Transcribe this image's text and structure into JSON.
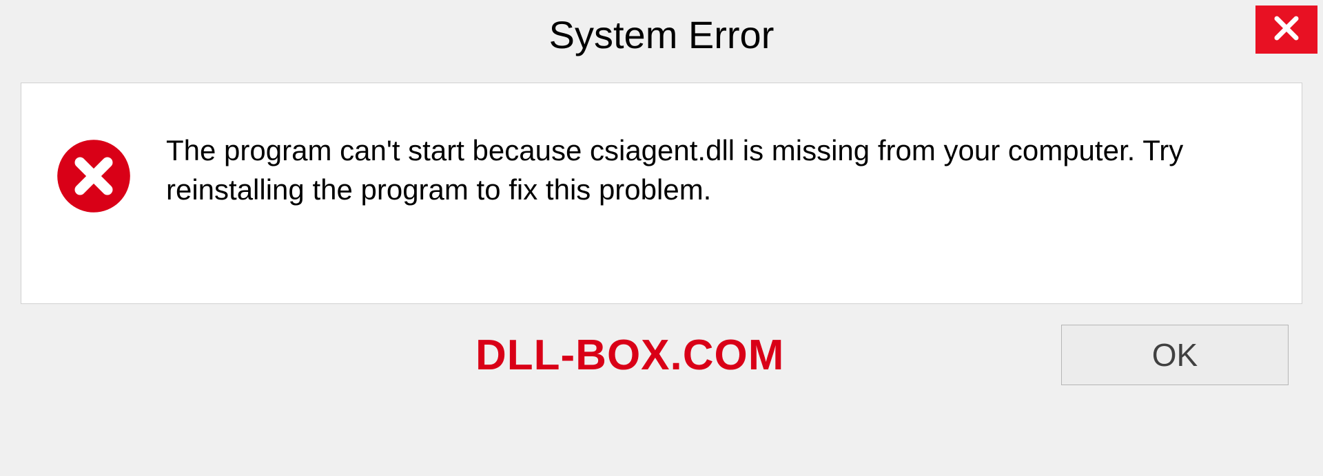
{
  "title": "System Error",
  "message": "The program can't start because csiagent.dll is missing from your computer. Try reinstalling the program to fix this problem.",
  "watermark": "DLL-BOX.COM",
  "ok_label": "OK",
  "colors": {
    "close_bg": "#e81123",
    "error_icon": "#d90017",
    "watermark": "#d90017"
  }
}
